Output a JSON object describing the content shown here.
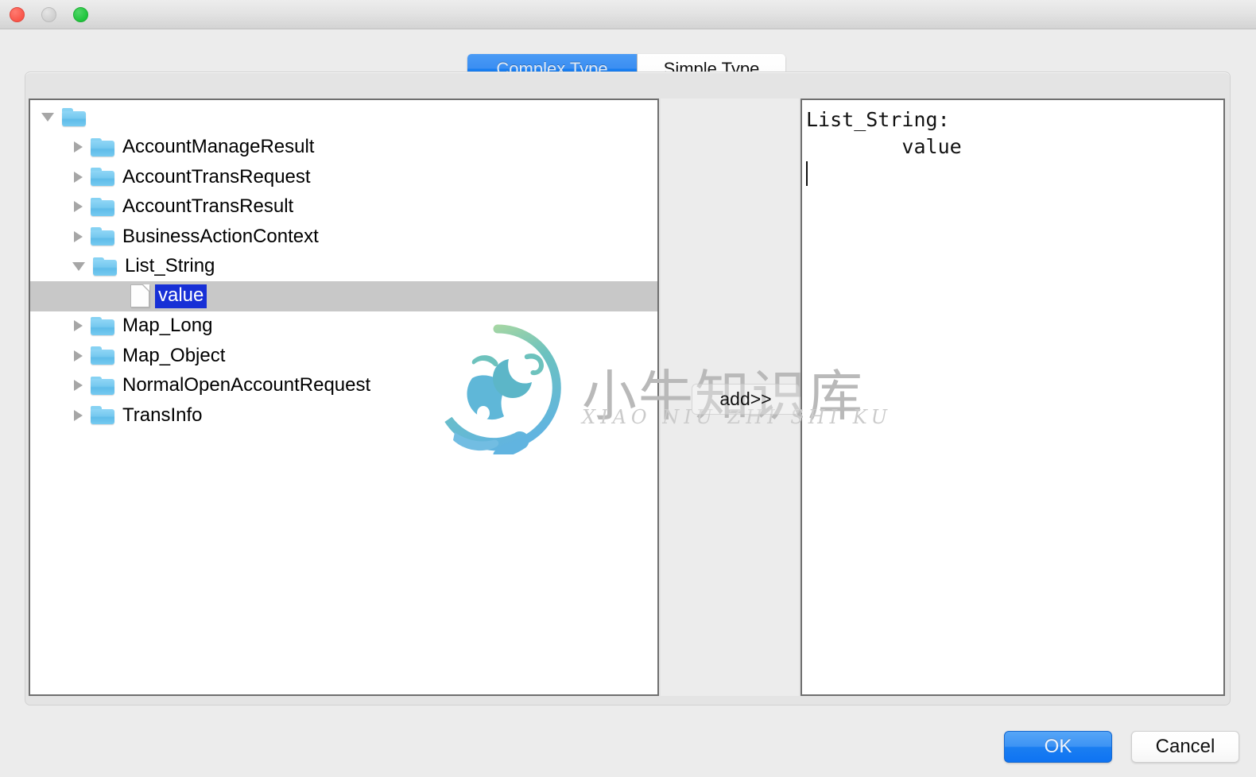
{
  "window": {
    "traffic_lights": [
      "close",
      "minimize",
      "zoom"
    ]
  },
  "tabs": [
    {
      "label": "Complex Type",
      "active": true
    },
    {
      "label": "Simple Type",
      "active": false
    }
  ],
  "tree": {
    "root": {
      "label": "",
      "icon": "folder-icon",
      "state": "expanded"
    },
    "items": [
      {
        "label": "AccountManageResult",
        "icon": "folder-icon",
        "state": "collapsed",
        "depth": 1,
        "selected": false
      },
      {
        "label": "AccountTransRequest",
        "icon": "folder-icon",
        "state": "collapsed",
        "depth": 1,
        "selected": false
      },
      {
        "label": "AccountTransResult",
        "icon": "folder-icon",
        "state": "collapsed",
        "depth": 1,
        "selected": false
      },
      {
        "label": "BusinessActionContext",
        "icon": "folder-icon",
        "state": "collapsed",
        "depth": 1,
        "selected": false
      },
      {
        "label": "List_String",
        "icon": "folder-icon",
        "state": "expanded",
        "depth": 1,
        "selected": false
      },
      {
        "label": "value",
        "icon": "file-icon",
        "state": "leaf",
        "depth": 2,
        "selected": true
      },
      {
        "label": "Map_Long",
        "icon": "folder-icon",
        "state": "collapsed",
        "depth": 1,
        "selected": false
      },
      {
        "label": "Map_Object",
        "icon": "folder-icon",
        "state": "collapsed",
        "depth": 1,
        "selected": false
      },
      {
        "label": "NormalOpenAccountRequest",
        "icon": "folder-icon",
        "state": "collapsed",
        "depth": 1,
        "selected": false
      },
      {
        "label": "TransInfo",
        "icon": "folder-icon",
        "state": "collapsed",
        "depth": 1,
        "selected": false
      }
    ]
  },
  "add_button": {
    "label": "add>>"
  },
  "editor": {
    "line1": "List_String:",
    "line2": "        value",
    "caret_line": 3
  },
  "watermark": {
    "text_cn": "小牛知识库",
    "text_en": "XIAO NIU ZHI SHI KU"
  },
  "footer": {
    "ok_label": "OK",
    "cancel_label": "Cancel"
  },
  "colors": {
    "accent_blue": "#1a7ef1",
    "selection_blue": "#1730d6",
    "row_highlight": "#c8c8c8",
    "folder_blue": "#77c9ef",
    "panel_border": "#6f6f6f",
    "window_bg": "#ececec"
  }
}
